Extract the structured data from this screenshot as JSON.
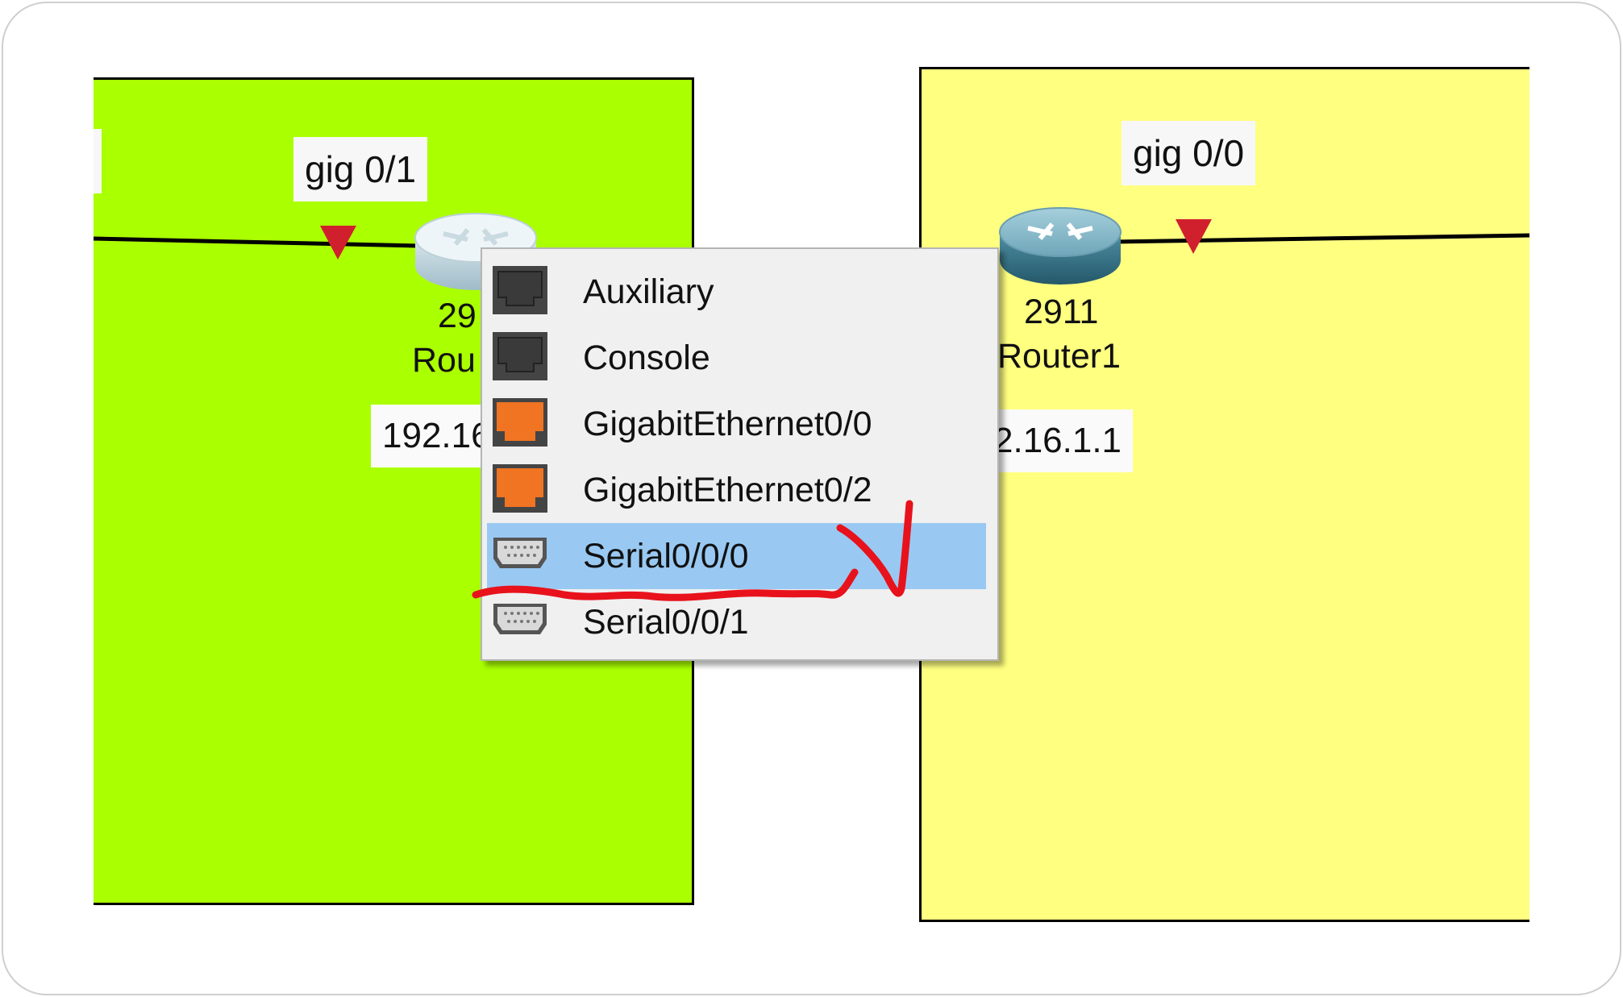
{
  "workspace": {
    "left_area_color": "#aaff00",
    "right_area_color": "#ffff80",
    "link_label_left": "gig 0/1",
    "link_label_right": "gig 0/0",
    "left_router": {
      "model": "29",
      "name": "Rou",
      "ip": "192.16"
    },
    "right_router": {
      "model": "2911",
      "name": "Router1",
      "ip": "2.16.1.1"
    },
    "link_status_color": "#d0202e"
  },
  "port_menu": {
    "items": [
      {
        "label": "Auxiliary",
        "icon": "rj45-port-icon",
        "color": "#444444"
      },
      {
        "label": "Console",
        "icon": "rj45-port-icon",
        "color": "#444444"
      },
      {
        "label": "GigabitEthernet0/0",
        "icon": "ethernet-port-icon",
        "color": "#f07422"
      },
      {
        "label": "GigabitEthernet0/2",
        "icon": "ethernet-port-icon",
        "color": "#f07422"
      },
      {
        "label": "Serial0/0/0",
        "icon": "serial-port-icon",
        "selected": true
      },
      {
        "label": "Serial0/0/1",
        "icon": "serial-port-icon"
      }
    ],
    "highlight_color": "#99c9f2"
  },
  "annotation": {
    "color": "#e8121c"
  }
}
